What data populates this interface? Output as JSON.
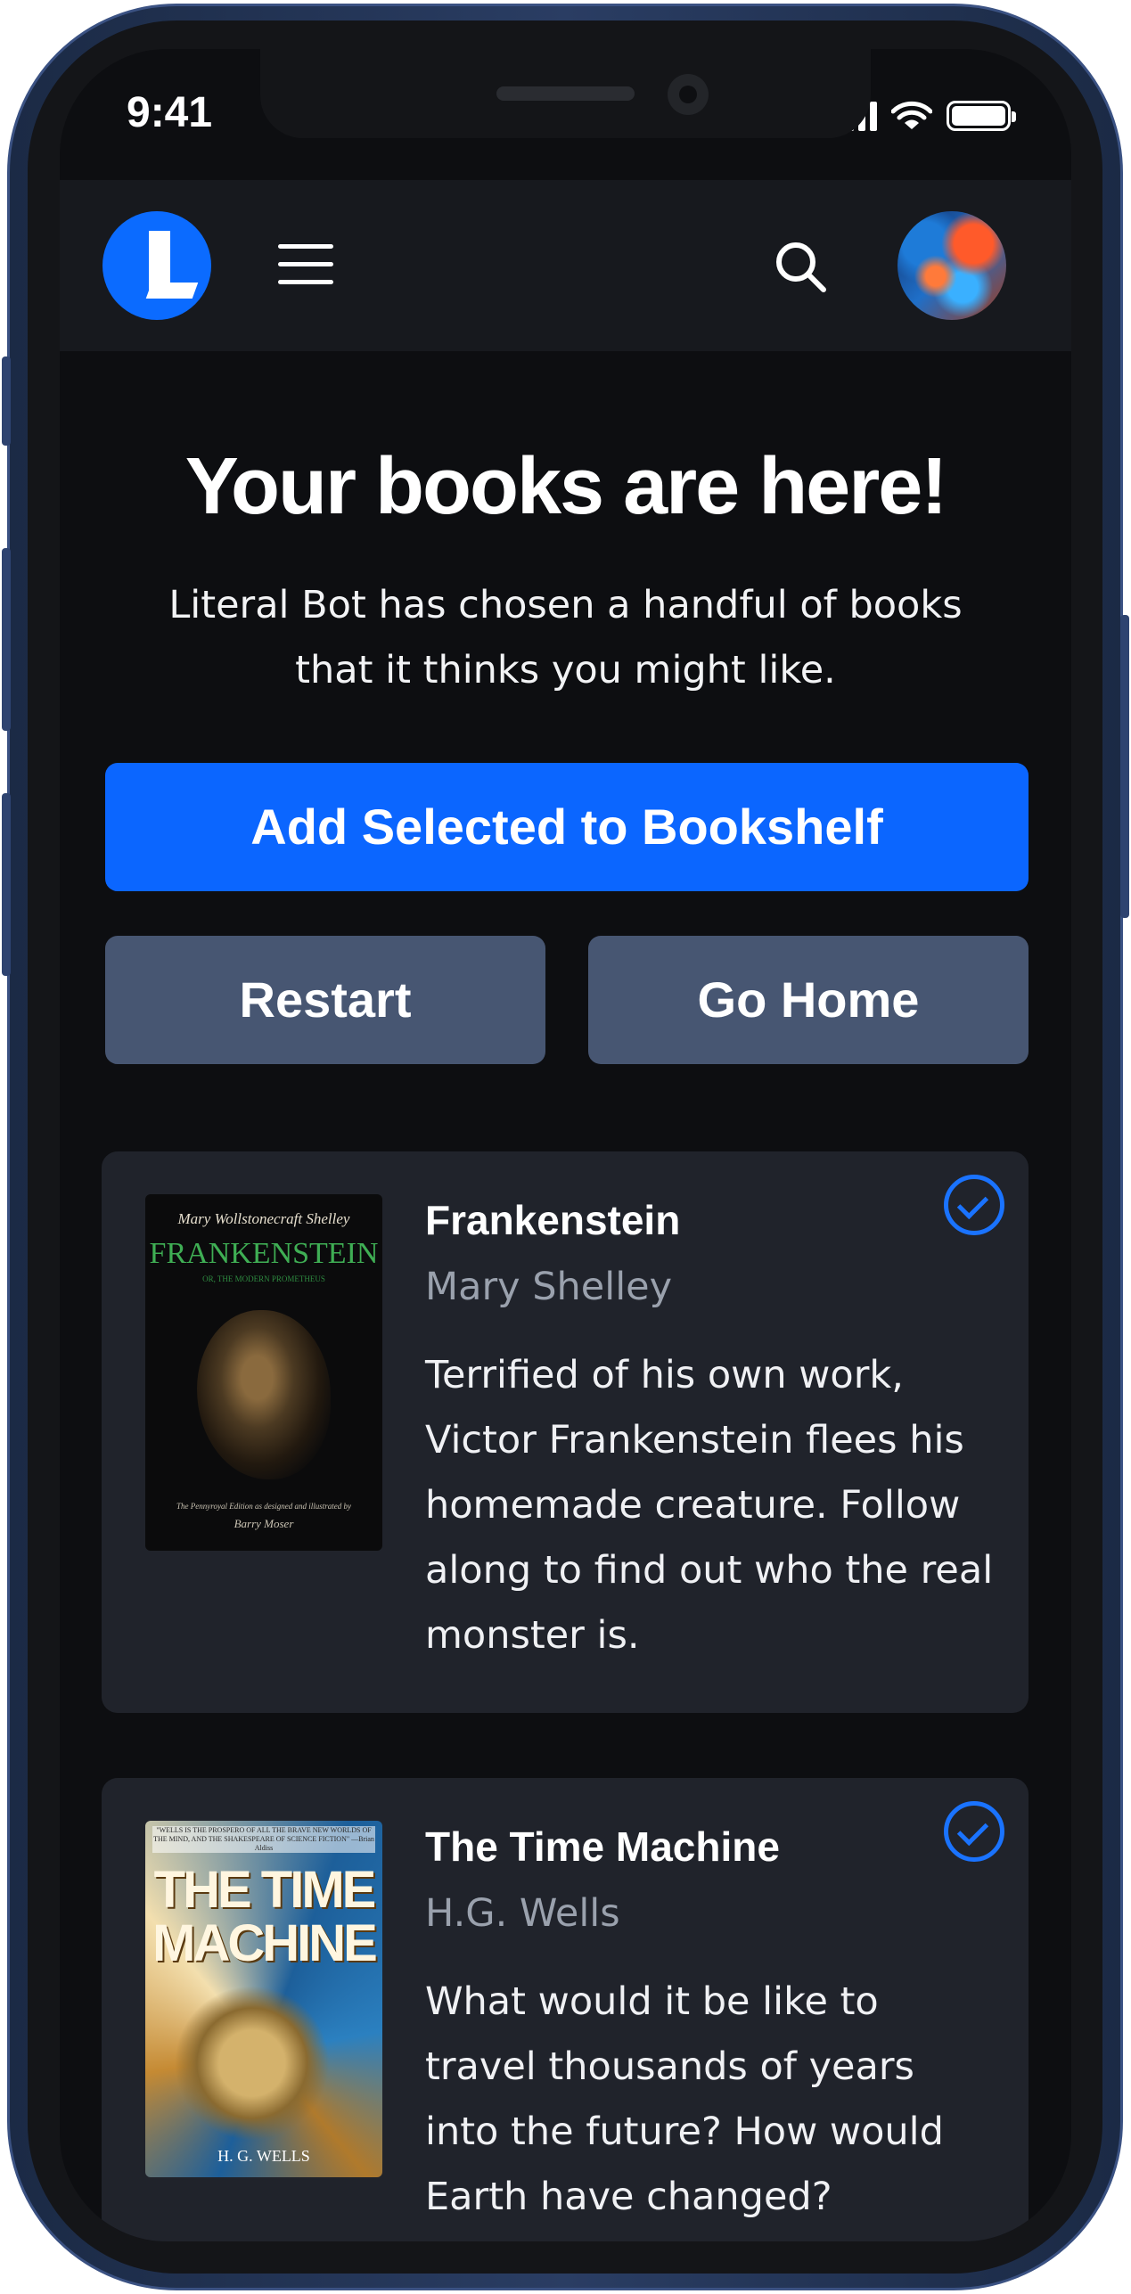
{
  "status_bar": {
    "time": "9:41"
  },
  "header": {
    "logo": "literal-logo-icon",
    "menu": "hamburger-menu-icon",
    "search": "search-icon",
    "avatar": "user-avatar"
  },
  "hero": {
    "title": "Your books are here!",
    "subtitle": "Literal Bot has chosen a handful of books that it thinks you might like."
  },
  "actions": {
    "primary_label": "Add Selected to Bookshelf",
    "restart_label": "Restart",
    "home_label": "Go Home"
  },
  "books": [
    {
      "title": "Frankenstein",
      "author": "Mary Shelley",
      "description": "Terrified of his own work, Victor Frankenstein flees his homemade creature. Follow along to find out who the real monster is.",
      "selected": true,
      "cover": {
        "author_text": "Mary Wollstonecraft Shelley",
        "title_text": "FRANKENSTEIN",
        "subtitle_text": "OR, THE MODERN PROMETHEUS",
        "footer_text": "The Pennyroyal Edition as designed and illustrated by",
        "illustrator_text": "Barry Moser"
      }
    },
    {
      "title": "The Time Machine",
      "author": "H.G. Wells",
      "description": "What would it be like to travel thousands of years into the future? How would Earth have changed?",
      "selected": true,
      "cover": {
        "quote_text": "\"WELLS IS THE PROSPERO OF ALL THE BRAVE NEW WORLDS OF THE MIND, AND THE SHAKESPEARE OF SCIENCE FICTION\" —Brian Aldiss",
        "title_text": "THE TIME MACHINE",
        "author_text": "H. G. WELLS"
      }
    }
  ],
  "colors": {
    "accent": "#0b66ff",
    "secondary_button": "#475672",
    "card": "#20232b",
    "background": "#0d0e11"
  }
}
